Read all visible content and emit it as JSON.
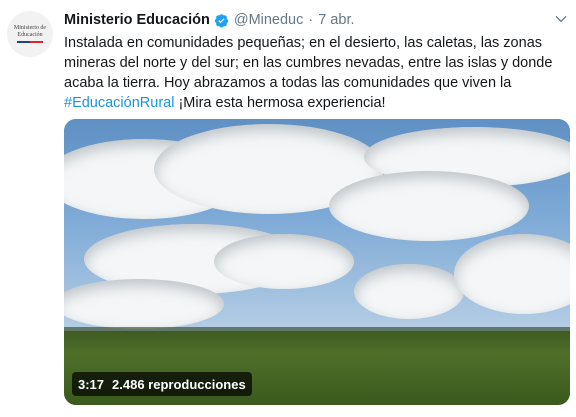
{
  "tweet": {
    "author_name": "Ministerio Educación",
    "handle": "@Mineduc",
    "separator": "·",
    "date": "7 abr.",
    "text_before_hashtag": "Instalada en comunidades pequeñas; en el desierto, las caletas, las zonas mineras del norte y del sur; en las cumbres nevadas, entre las islas y donde acaba la tierra. Hoy abrazamos a todas las comunidades que viven la ",
    "hashtag": "#EducaciónRural",
    "text_after_hashtag": " ¡Mira esta hermosa experiencia!",
    "avatar_text_line1": "Ministerio de",
    "avatar_text_line2": "Educación"
  },
  "video": {
    "duration": "3:17",
    "views": "2.486 reproducciones"
  },
  "icons": {
    "verified": "verified-badge-icon",
    "menu": "chevron-down-icon"
  },
  "colors": {
    "hashtag": "#1b95e0",
    "verified": "#1da1f2",
    "handle": "#657786"
  }
}
